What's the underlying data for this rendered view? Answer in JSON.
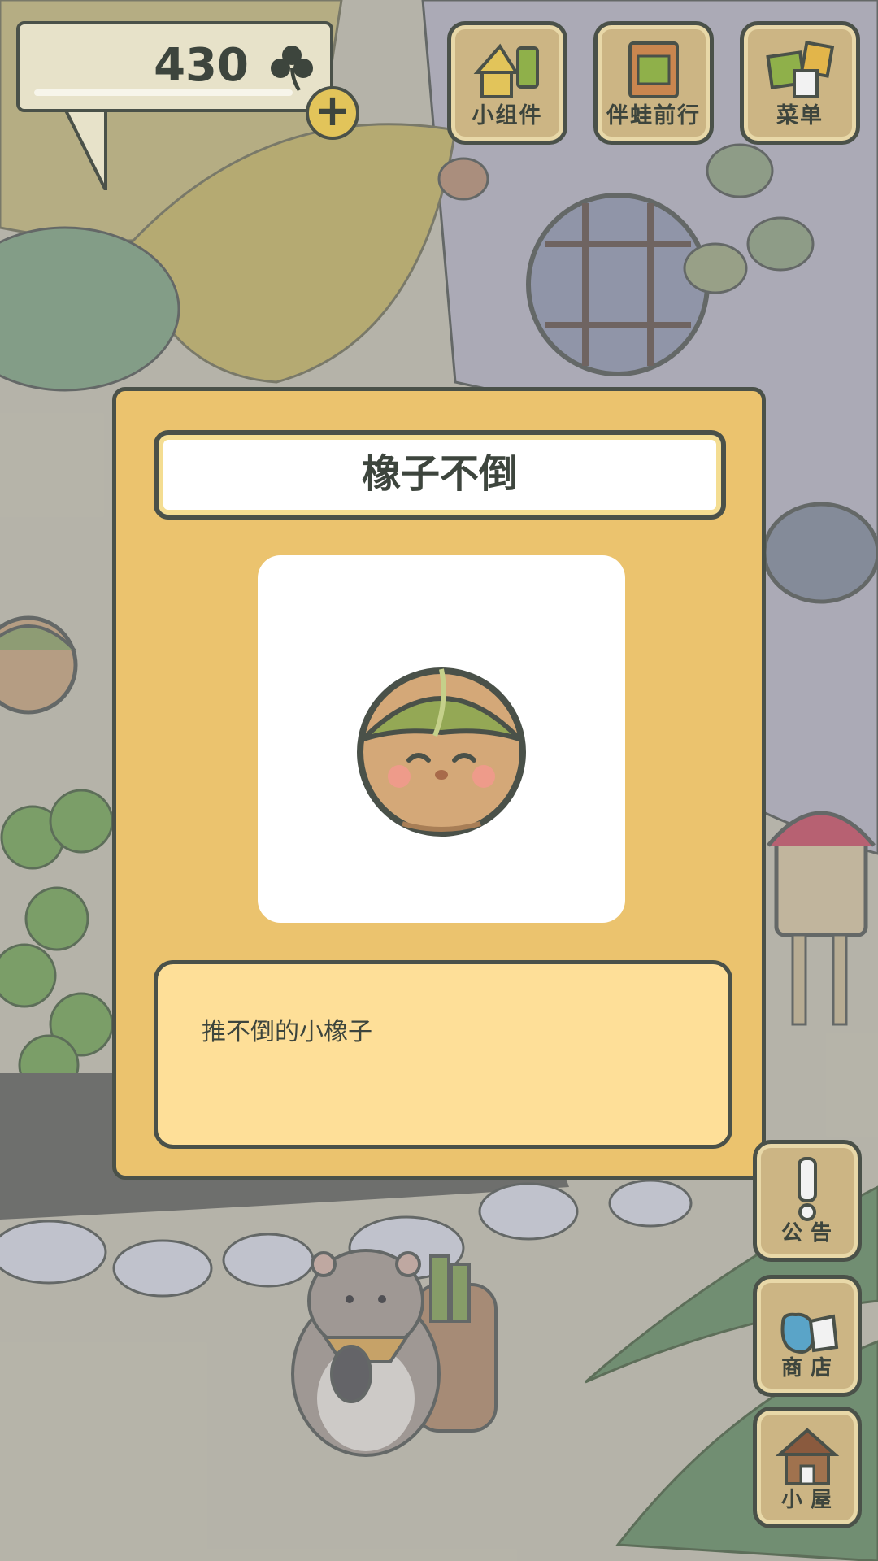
{
  "hud": {
    "clover_count": "430",
    "plus_label": "+"
  },
  "top_buttons": {
    "widgets": "小组件",
    "travel": "伴蛙前行",
    "menu": "菜单"
  },
  "dialog": {
    "title": "橡子不倒",
    "item_icon": "acorn-tumbler-icon",
    "description": "推不倒的小橡子"
  },
  "side_buttons": {
    "notice": "公告",
    "shop": "商店",
    "house": "小屋"
  },
  "colors": {
    "dialog_bg": "#ebc36e",
    "description_bg": "#fedf98",
    "button_wood": "#ccb584",
    "outline": "#4a5149",
    "text": "#3d453d"
  }
}
